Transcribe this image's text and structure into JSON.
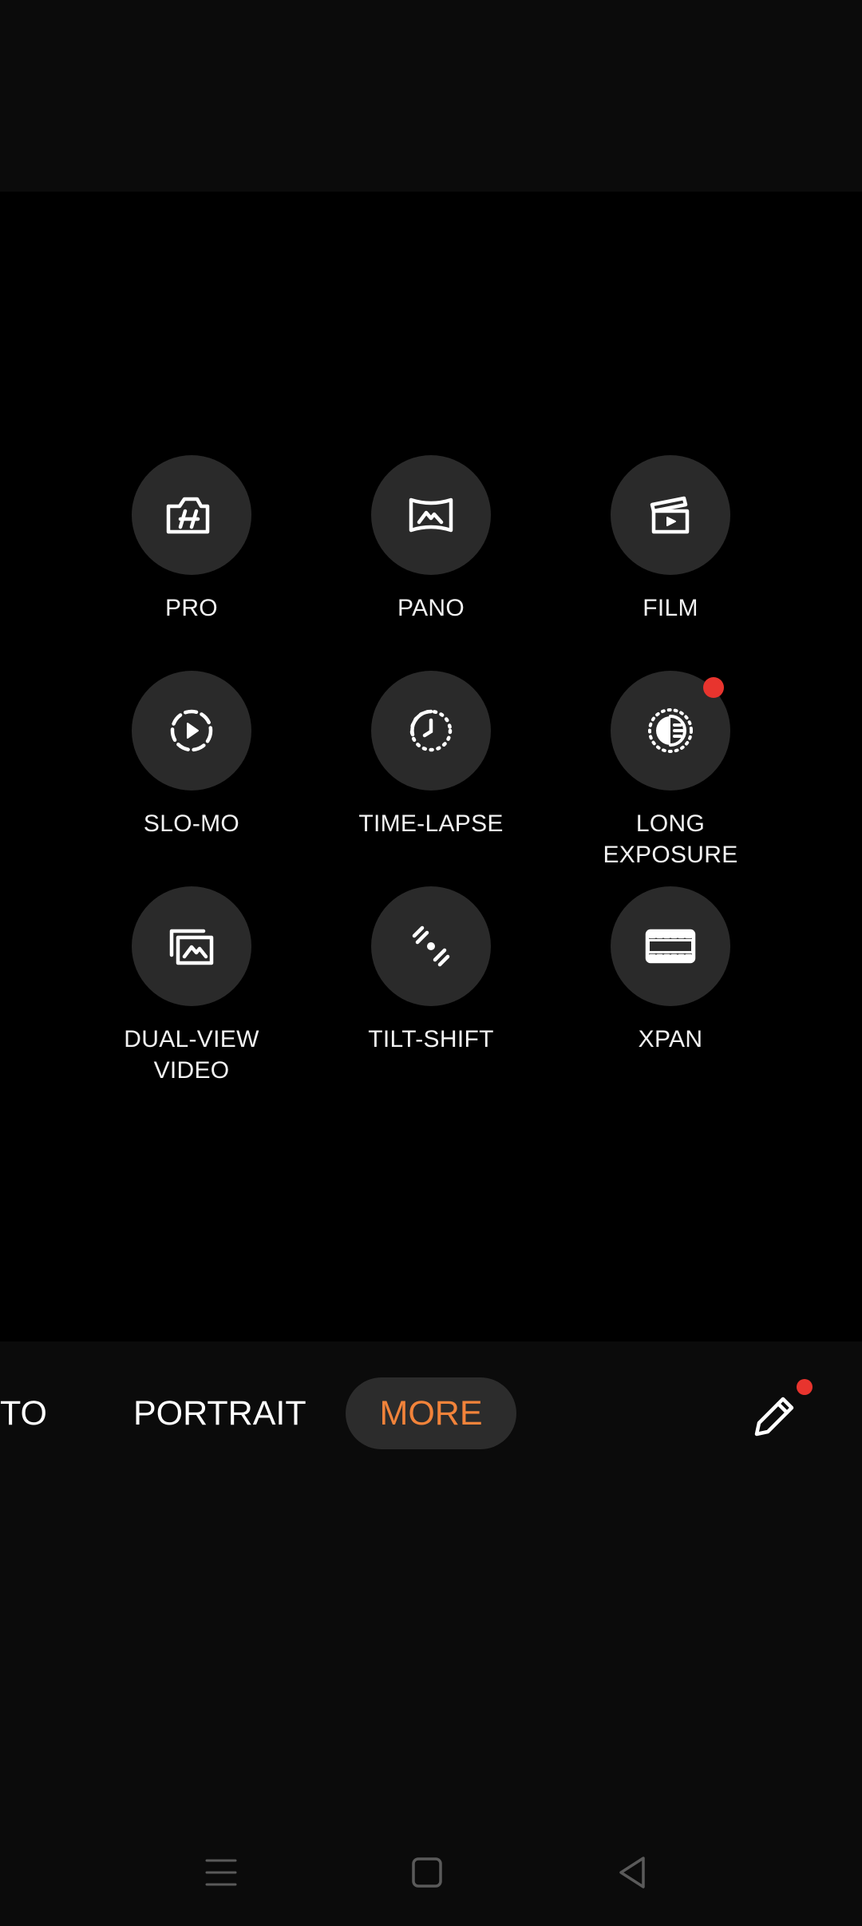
{
  "modes": [
    {
      "id": "pro",
      "label": "PRO",
      "icon": "hasselblad-camera-icon",
      "badge": false
    },
    {
      "id": "pano",
      "label": "PANO",
      "icon": "panorama-icon",
      "badge": false
    },
    {
      "id": "film",
      "label": "FILM",
      "icon": "clapperboard-icon",
      "badge": false
    },
    {
      "id": "slo-mo",
      "label": "SLO-MO",
      "icon": "slow-motion-icon",
      "badge": false
    },
    {
      "id": "time-lapse",
      "label": "TIME-LAPSE",
      "icon": "time-lapse-icon",
      "badge": false
    },
    {
      "id": "long-exposure",
      "label": "LONG\nEXPOSURE",
      "icon": "long-exposure-icon",
      "badge": true
    },
    {
      "id": "dual-view-video",
      "label": "DUAL-VIEW\nVIDEO",
      "icon": "dual-view-icon",
      "badge": false
    },
    {
      "id": "tilt-shift",
      "label": "TILT-SHIFT",
      "icon": "tilt-shift-icon",
      "badge": false
    },
    {
      "id": "xpan",
      "label": "XPAN",
      "icon": "xpan-film-icon",
      "badge": false
    }
  ],
  "mode_bar": {
    "photo_partial": "TO",
    "portrait": "PORTRAIT",
    "more": "MORE",
    "edit_icon": "pencil-icon",
    "edit_badge": true
  },
  "nav": {
    "recents_icon": "menu-lines-icon",
    "home_icon": "square-home-icon",
    "back_icon": "triangle-back-icon"
  },
  "colors": {
    "accent": "#f2833a",
    "badge": "#e8342e",
    "tile": "#2a2a2a"
  }
}
